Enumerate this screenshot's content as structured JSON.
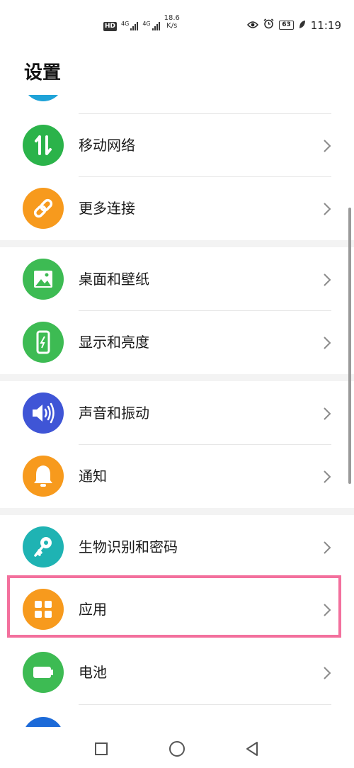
{
  "status_bar": {
    "hd_label": "HD",
    "net_tag_1": "4G",
    "net_tag_2": "4G",
    "net_speed": "18.6\nK/s",
    "battery": "63",
    "time": "11:19"
  },
  "page": {
    "title": "设置"
  },
  "settings": {
    "items": [
      {
        "label": "移动网络",
        "icon": "mobile-data-icon",
        "color": "#2bb34a"
      },
      {
        "label": "更多连接",
        "icon": "link-icon",
        "color": "#f79a1d"
      },
      {
        "label": "桌面和壁纸",
        "icon": "wallpaper-icon",
        "color": "#3dbb53"
      },
      {
        "label": "显示和亮度",
        "icon": "display-icon",
        "color": "#3dbb53"
      },
      {
        "label": "声音和振动",
        "icon": "sound-icon",
        "color": "#3f55d6"
      },
      {
        "label": "通知",
        "icon": "bell-icon",
        "color": "#f79a1d"
      },
      {
        "label": "生物识别和密码",
        "icon": "key-icon",
        "color": "#1fb3b3"
      },
      {
        "label": "应用",
        "icon": "apps-grid-icon",
        "color": "#f79a1d"
      },
      {
        "label": "电池",
        "icon": "battery-icon",
        "color": "#3dbb53"
      }
    ]
  },
  "highlight_color": "#f3709d",
  "nav_bar": {
    "recent": "square-icon",
    "home": "circle-icon",
    "back": "triangle-back-icon"
  }
}
